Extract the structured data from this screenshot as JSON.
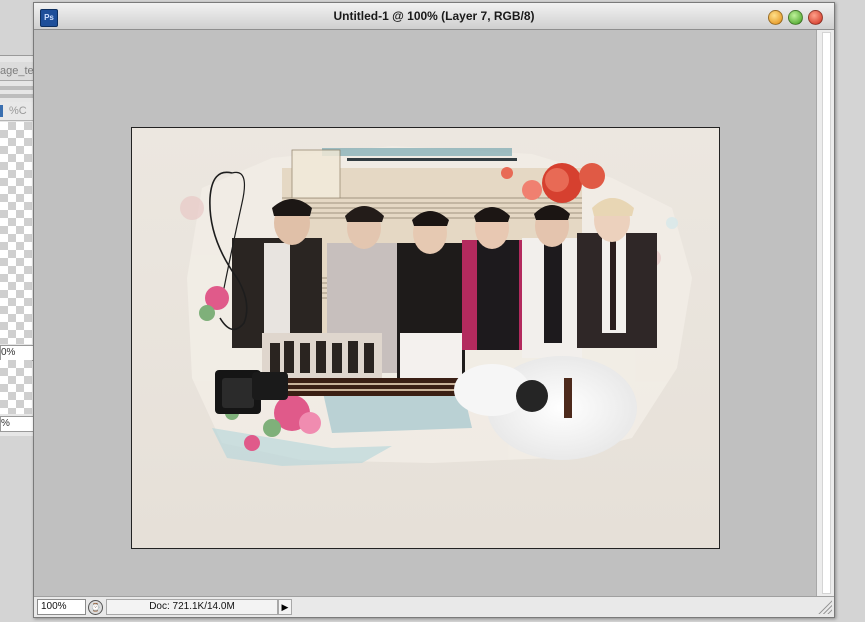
{
  "background_panel": {
    "tab_text": "age_te",
    "control_text": "%C",
    "field1_value": "0%",
    "field2_value": "%"
  },
  "window": {
    "app_icon": "Ps",
    "title": "Untitled-1 @ 100% (Layer 7, RGB/8)",
    "colors": {
      "accent": "#1e4f9a",
      "canvas_bg": "#c0c0c0"
    }
  },
  "status": {
    "zoom": "100%",
    "doc_info": "Doc: 721.1K/14.0M"
  },
  "artwork": {
    "description_icon": "collage-image"
  }
}
